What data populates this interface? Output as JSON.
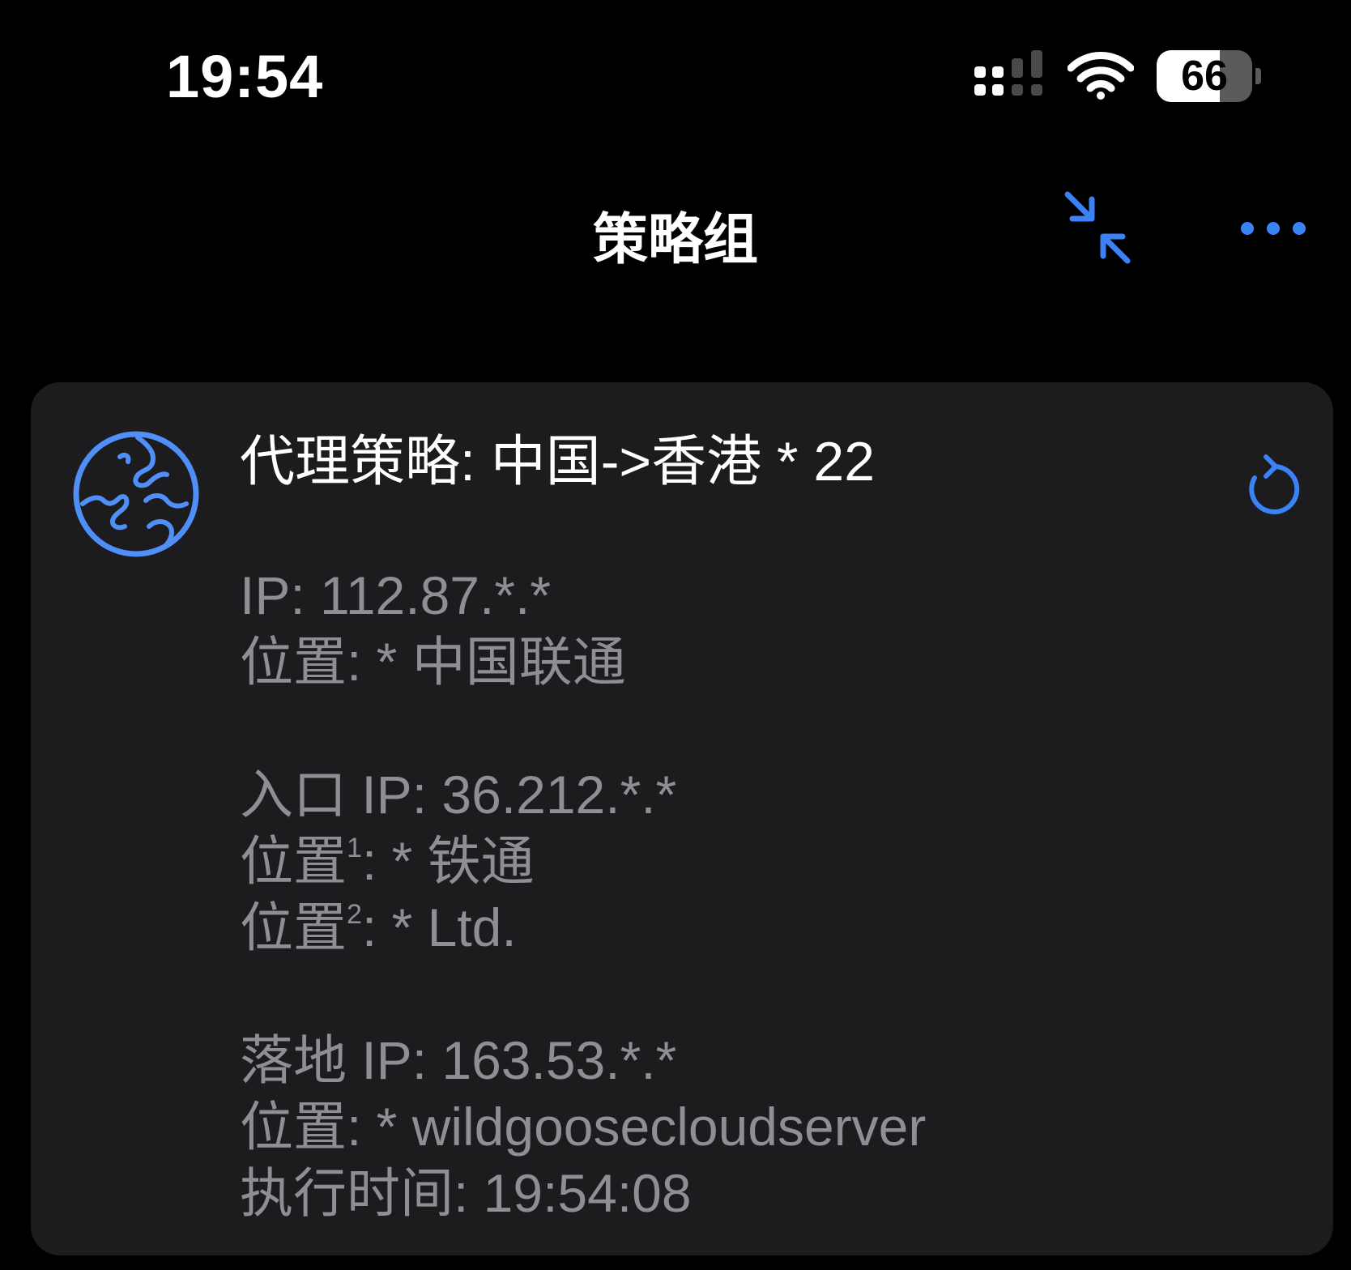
{
  "status_bar": {
    "time": "19:54",
    "battery_level": 66,
    "battery_text": "66"
  },
  "nav": {
    "title": "策略组",
    "accent_color": "#3b82f6"
  },
  "card": {
    "title": "代理策略: 中国->香港 * 22",
    "sections": {
      "proxy_ip": "IP: 112.87.*.*",
      "proxy_location": "位置: * 中国联通",
      "entry_ip": "入口 IP: 36.212.*.*",
      "entry_location_1_label": "位置",
      "entry_location_1_sup": "1",
      "entry_location_1_value": ": * 铁通",
      "entry_location_2_label": "位置",
      "entry_location_2_sup": "2",
      "entry_location_2_value": ": * Ltd.",
      "landing_ip": "落地 IP: 163.53.*.*",
      "landing_location": "位置: * wildgoosecloudserver",
      "exec_time": "执行时间: 19:54:08"
    }
  }
}
